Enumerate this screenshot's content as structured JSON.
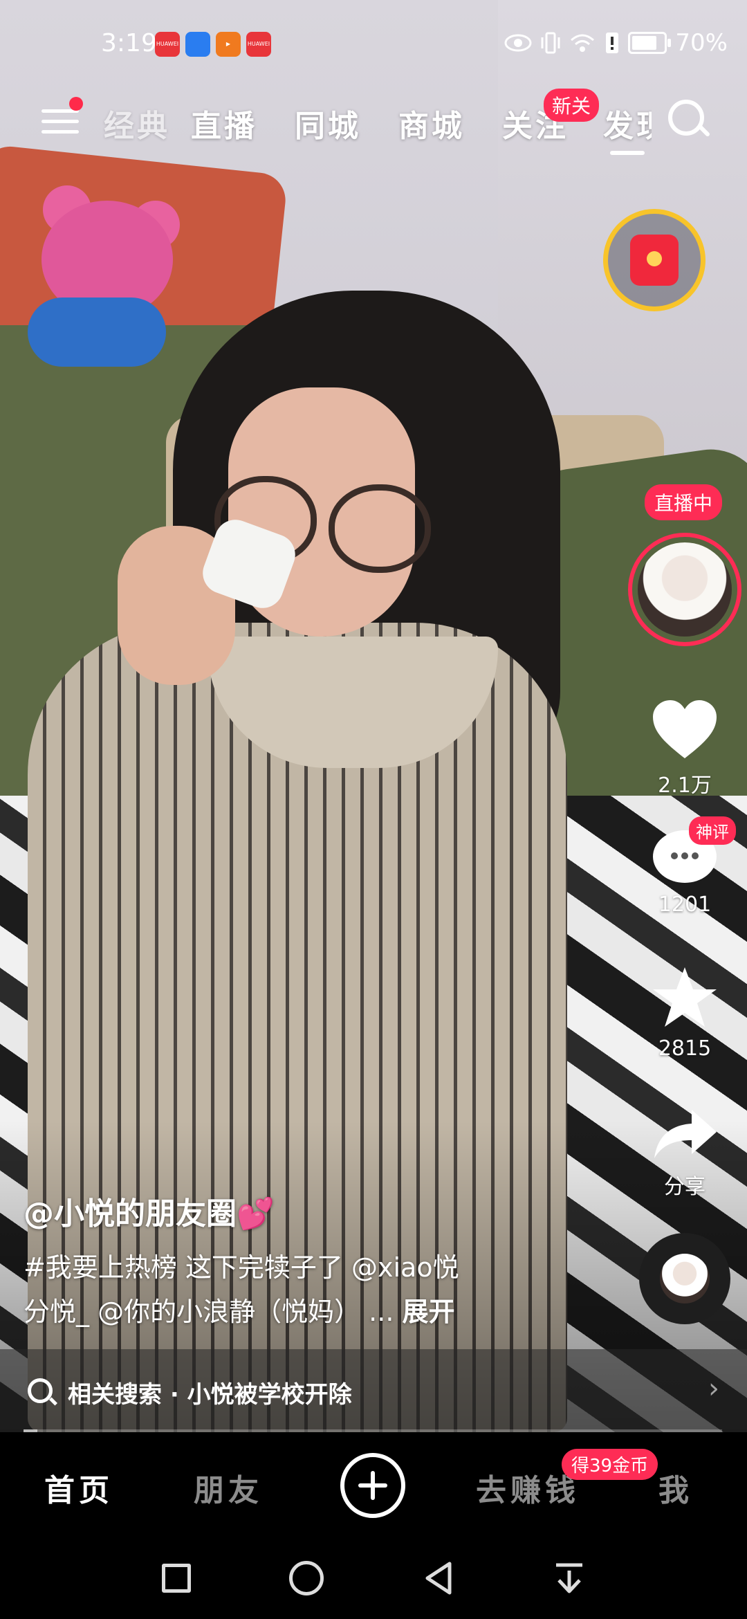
{
  "status_bar": {
    "time": "3:19",
    "battery_percent": "70%",
    "battery_level": 0.7,
    "mini_apps": [
      "HUAWEI",
      "",
      "",
      "HUAWEI"
    ]
  },
  "top_nav": {
    "tabs": [
      "经典",
      "直播",
      "同城",
      "商城",
      "关注",
      "发现"
    ],
    "new_badge": "新关",
    "active_tab_index": 5
  },
  "right_column": {
    "live_badge": "直播中",
    "like_count": "2.1万",
    "comment_badge": "神评",
    "comment_count": "1201",
    "favorite_count": "2815",
    "share_label": "分享"
  },
  "caption": {
    "author": "@小悦的朋友圈💕",
    "description_line1": "#我要上热榜 这下完犊子了 @xiao悦",
    "description_line2": "分悦_ @你的小浪静（悦妈） ... ",
    "expand_label": "展开"
  },
  "related_search": {
    "text": "相关搜索 · 小悦被学校开除",
    "chevron": "›"
  },
  "video_progress": 0.02,
  "bottom_tabs": {
    "home": "首页",
    "friends": "朋友",
    "earn": "去赚钱",
    "coin_badge": "得39金币",
    "me": "我"
  },
  "colors": {
    "accent": "#fe2c55",
    "redpacket_ring": "#f8c42a"
  }
}
